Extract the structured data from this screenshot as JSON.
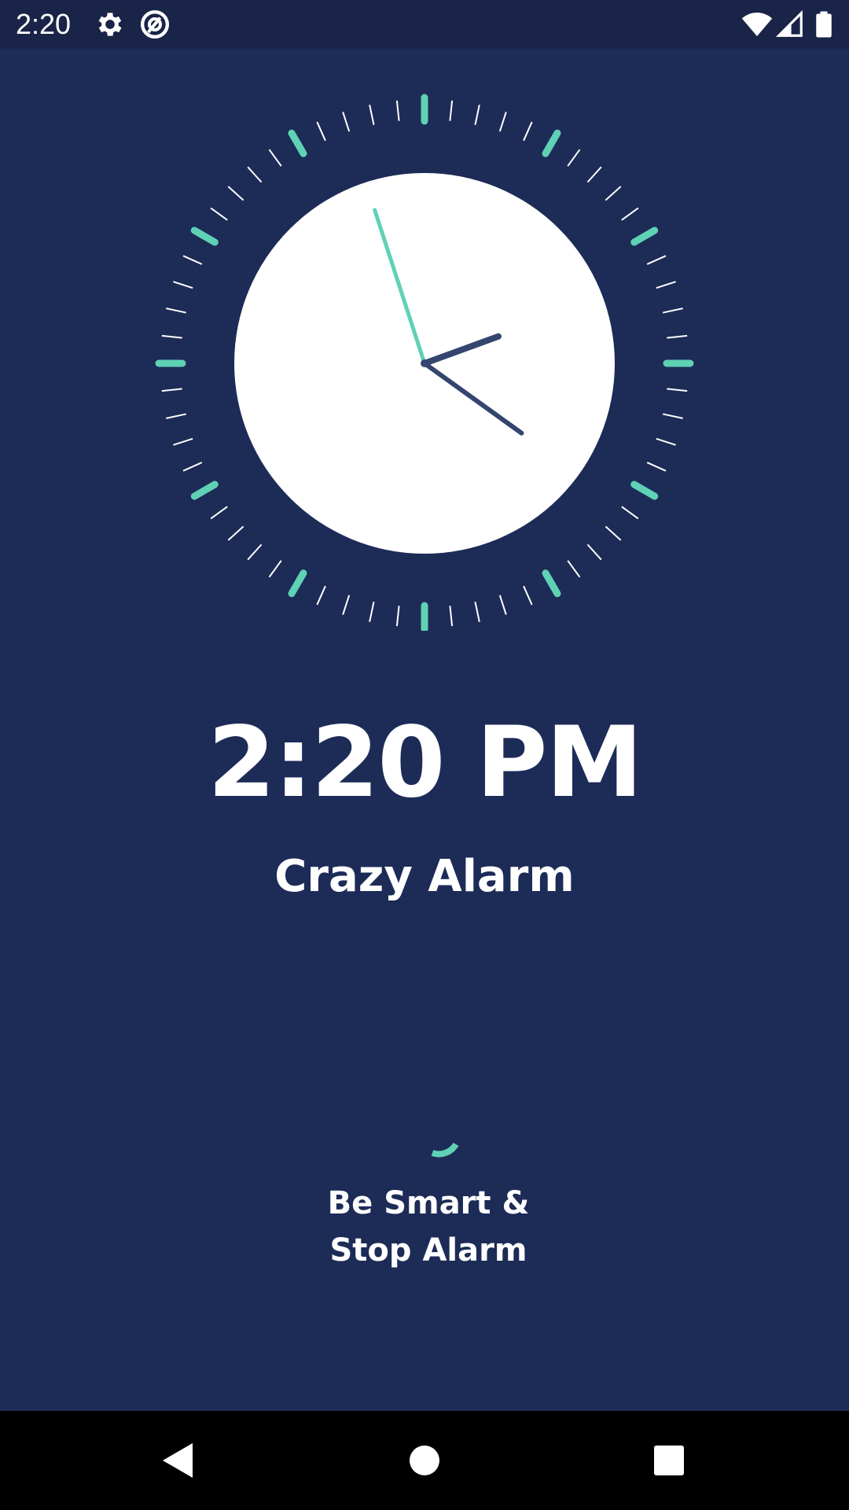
{
  "status_bar": {
    "time": "2:20",
    "icons": [
      "gear-icon",
      "sync-circle-icon",
      "wifi-icon",
      "cellular-signal-icon",
      "battery-icon"
    ]
  },
  "clock": {
    "hour": 2,
    "minute": 20,
    "second": 57,
    "colors": {
      "face": "#ffffff",
      "accent": "#5fd1b4",
      "tick": "#ffffff",
      "hands": "#34456f"
    }
  },
  "alarm": {
    "time_label": "2:20 PM",
    "name": "Crazy Alarm"
  },
  "stop_button": {
    "line1": "Be Smart &",
    "line2": "Stop Alarm"
  },
  "navigation": {
    "back": "back-icon",
    "home": "home-icon",
    "recents": "recents-icon"
  },
  "colors": {
    "background": "#1d2b57",
    "status_bar": "#1a2448",
    "accent": "#5fd1b4"
  }
}
